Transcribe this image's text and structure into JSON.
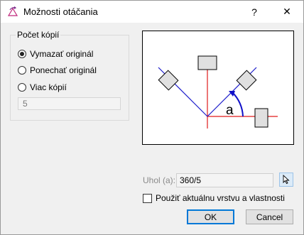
{
  "window": {
    "title": "Možnosti otáčania",
    "help_glyph": "?",
    "close_glyph": "✕",
    "icon": "rotate-app-icon"
  },
  "copies_group": {
    "legend": "Počet kópií",
    "options": [
      {
        "label": "Vymazať originál",
        "checked": true
      },
      {
        "label": "Ponechať originál",
        "checked": false
      },
      {
        "label": "Viac kópií",
        "checked": false
      }
    ],
    "copies_value": "5"
  },
  "preview": {
    "angle_letter": "a",
    "colors": {
      "axis": "#e01b1b",
      "rotation_line": "#1a1acb",
      "arrow": "#1010c8",
      "box_fill": "#e0e0e0"
    }
  },
  "angle": {
    "label": "Uhol (a):",
    "value": "360/5"
  },
  "use_current_layer": {
    "label": "Použiť aktuálnu vrstvu a vlastnosti",
    "checked": false
  },
  "buttons": {
    "ok": "OK",
    "cancel": "Cancel"
  }
}
